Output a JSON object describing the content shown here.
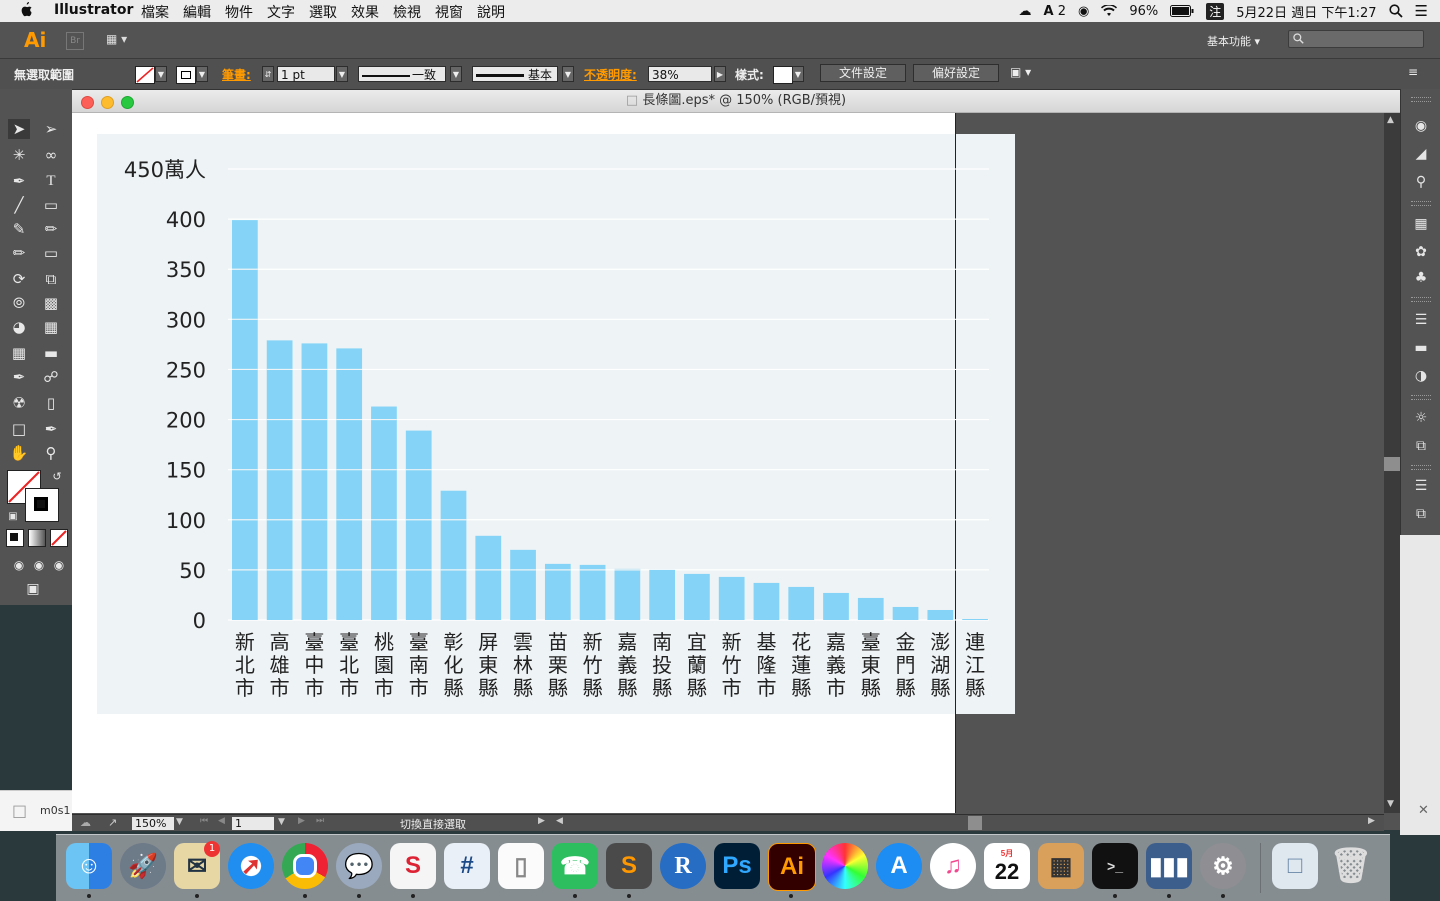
{
  "menubar": {
    "app_name": "Illustrator",
    "menus": [
      "檔案",
      "編輯",
      "物件",
      "文字",
      "選取",
      "效果",
      "檢視",
      "視窗",
      "說明"
    ],
    "battery": "96%",
    "input_method": "注",
    "adobe_badge": "2",
    "datetime": "5月22日 週日 下午1:27"
  },
  "appbar": {
    "logo": "Ai",
    "bridge": "Br",
    "workspace": "基本功能",
    "workspace_arrow": "▾",
    "search_icon": "search-icon"
  },
  "controlbar": {
    "selection": "無選取範圍",
    "stroke_label": "筆畫:",
    "stroke_value": "1 pt",
    "profile1": "一致",
    "profile2": "基本",
    "opacity_label": "不透明度:",
    "opacity_value": "38%",
    "style_label": "樣式:",
    "doc_setup": "文件設定",
    "prefs": "偏好設定"
  },
  "document": {
    "title": "長條圖.eps* @ 150% (RGB/預視)",
    "zoom": "150%",
    "page": "1",
    "status": "切換直接選取"
  },
  "finder_sidebar": {
    "filename": "m0s1"
  },
  "dock": {
    "apps": [
      "Finder",
      "Launchpad",
      "Mail",
      "Safari",
      "Chrome",
      "Messages",
      "Slack",
      "Code",
      "Files",
      "Evernote",
      "Sublime",
      "R",
      "Ps",
      "Ai",
      "Colors",
      "App Store",
      "iTunes",
      "Calendar",
      "Calculator",
      "Terminal",
      "Stats",
      "System Preferences",
      "Documents",
      "Trash"
    ],
    "mail_badge": "1",
    "calendar_month": "5月",
    "calendar_day": "22"
  },
  "chart_data": {
    "type": "bar",
    "unit_label": "450萬人",
    "ylim": [
      0,
      450
    ],
    "yticks": [
      "400",
      "350",
      "300",
      "250",
      "200",
      "150",
      "100",
      "50",
      "0"
    ],
    "categories": [
      "新北市",
      "高雄市",
      "臺中市",
      "臺北市",
      "桃園市",
      "臺南市",
      "彰化縣",
      "屏東縣",
      "雲林縣",
      "苗栗縣",
      "新竹縣",
      "嘉義縣",
      "南投縣",
      "宜蘭縣",
      "新竹市",
      "基隆市",
      "花蓮縣",
      "嘉義市",
      "臺東縣",
      "金門縣",
      "澎湖縣",
      "連江縣"
    ],
    "values": [
      399,
      279,
      276,
      271,
      213,
      189,
      129,
      84,
      70,
      56,
      55,
      51,
      50,
      46,
      43,
      37,
      33,
      27,
      22,
      13,
      10,
      1
    ],
    "bar_color": "#85d4f7",
    "grid": true
  }
}
